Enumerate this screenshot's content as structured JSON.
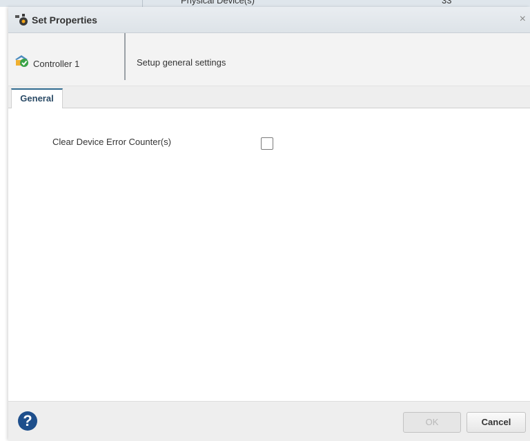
{
  "background": {
    "row_text": "Physical Device(s)",
    "row_count": "33"
  },
  "dialog": {
    "title": "Set Properties",
    "close_glyph": "×",
    "title_icon": "controller-settings-icon"
  },
  "header": {
    "controller_label": "Controller 1",
    "controller_icon": "controller-ok-icon",
    "subtitle": "Setup general settings"
  },
  "tabs": [
    {
      "label": "General",
      "active": true
    }
  ],
  "general": {
    "clear_counters_label": "Clear Device Error Counter(s)",
    "clear_counters_checked": false
  },
  "footer": {
    "help_glyph": "?",
    "ok_label": "OK",
    "ok_enabled": false,
    "cancel_label": "Cancel"
  },
  "colors": {
    "titlebar": "#e3e8ec",
    "tab_accent": "#2f6b8f",
    "help": "#1e4f8c"
  }
}
